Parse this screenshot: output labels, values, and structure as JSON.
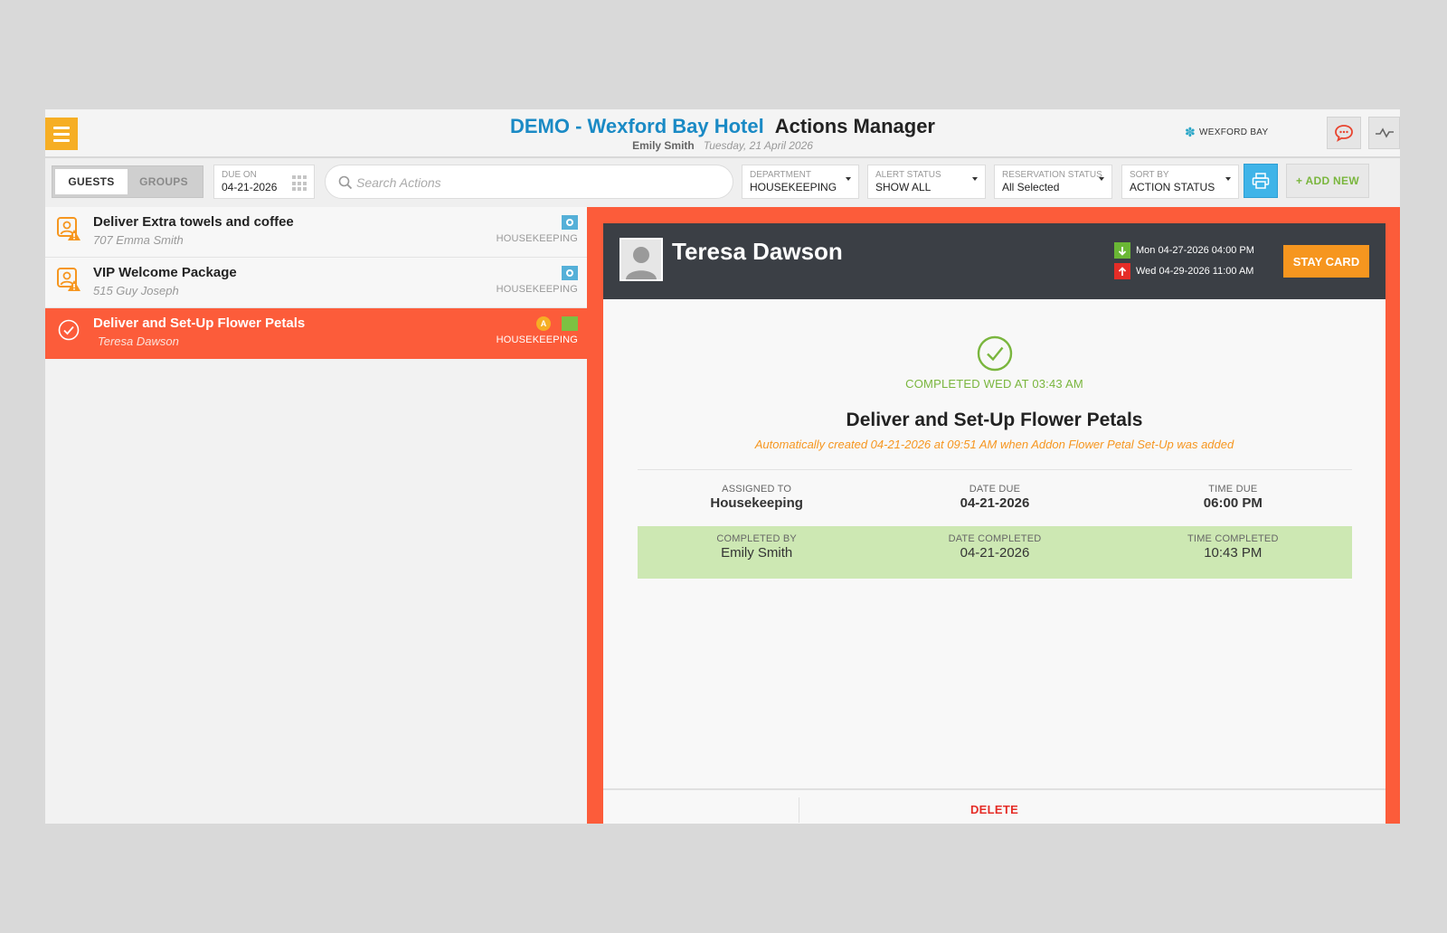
{
  "header": {
    "hotel_name": "DEMO - Wexford Bay Hotel",
    "page_title": "Actions Manager",
    "user": "Emily Smith",
    "date": "Tuesday, 21 April 2026",
    "brand": "WEXFORD BAY"
  },
  "toolbar": {
    "tabs": [
      {
        "label": "GUESTS",
        "active": true
      },
      {
        "label": "GROUPS",
        "active": false
      }
    ],
    "due_on": {
      "label": "DUE ON",
      "value": "04-21-2026"
    },
    "search": {
      "placeholder": "Search Actions",
      "value": ""
    },
    "filters": [
      {
        "label": "DEPARTMENT",
        "value": "HOUSEKEEPING"
      },
      {
        "label": "ALERT STATUS",
        "value": "SHOW ALL"
      },
      {
        "label": "RESERVATION STATUS",
        "value": "All Selected"
      },
      {
        "label": "SORT BY",
        "value": "ACTION STATUS"
      }
    ],
    "add_label": "+ ADD NEW"
  },
  "actions": [
    {
      "title": "Deliver Extra towels and coffee",
      "subtitle": "707 Emma Smith",
      "department": "HOUSEKEEPING",
      "state": "open"
    },
    {
      "title": "VIP Welcome Package",
      "subtitle": "515 Guy Joseph",
      "department": "HOUSEKEEPING",
      "state": "open"
    },
    {
      "title": "Deliver and Set-Up Flower Petals",
      "subtitle": "Teresa Dawson",
      "department": "HOUSEKEEPING",
      "state": "completed",
      "alert_badge": "A"
    }
  ],
  "detail": {
    "guest_name": "Teresa Dawson",
    "arrival": "Mon 04-27-2026  04:00 PM",
    "departure": "Wed 04-29-2026  11:00 AM",
    "stay_card_label": "STAY CARD",
    "completed_text": "COMPLETED WED AT 03:43 AM",
    "title": "Deliver and Set-Up Flower Petals",
    "note": "Automatically created 04-21-2026 at 09:51 AM when Addon Flower Petal Set-Up was added",
    "assigned": [
      {
        "label": "ASSIGNED TO",
        "value": "Housekeeping"
      },
      {
        "label": "DATE DUE",
        "value": "04-21-2026"
      },
      {
        "label": "TIME DUE",
        "value": "06:00 PM"
      }
    ],
    "completed": [
      {
        "label": "COMPLETED BY",
        "value": "Emily Smith"
      },
      {
        "label": "DATE COMPLETED",
        "value": "04-21-2026"
      },
      {
        "label": "TIME COMPLETED",
        "value": "10:43 PM"
      }
    ],
    "delete_label": "DELETE"
  },
  "colors": {
    "accent": "#fc5c3a",
    "menu": "#f6ae24",
    "hotel": "#1a8ac5",
    "success": "#7ab63e",
    "completed_row": "#cde8b3",
    "stay_card": "#f6961f",
    "delete": "#e52d27"
  },
  "icons": {
    "menu": "hamburger-icon",
    "chat": "chat-bubble-icon",
    "activity": "activity-icon",
    "search": "search-icon",
    "calendar": "calendar-grid-icon",
    "print": "print-icon",
    "guest_alert": "guest-warning-icon",
    "check": "check-circle-icon",
    "arrival": "arrow-down-icon",
    "departure": "arrow-up-icon"
  }
}
